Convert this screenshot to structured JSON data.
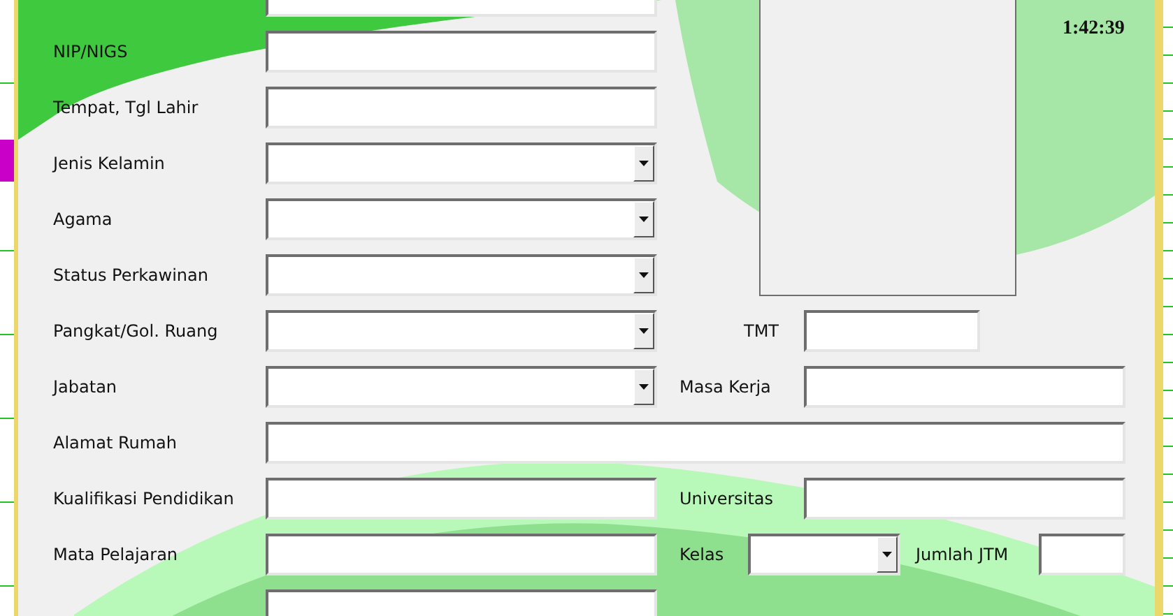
{
  "clock": "1:42:39",
  "rows": [
    {
      "fields": [
        {
          "kind": "text"
        }
      ]
    },
    {
      "fields": [
        {
          "label": "NIP/NIGS",
          "kind": "text"
        }
      ]
    },
    {
      "fields": [
        {
          "label": "Tempat, Tgl Lahir",
          "kind": "text"
        }
      ]
    },
    {
      "fields": [
        {
          "label": "Jenis Kelamin",
          "kind": "combo"
        }
      ]
    },
    {
      "fields": [
        {
          "label": "Agama",
          "kind": "combo"
        }
      ]
    },
    {
      "fields": [
        {
          "label": "Status Perkawinan",
          "kind": "combo"
        }
      ]
    },
    {
      "fields": [
        {
          "label": "Pangkat/Gol. Ruang",
          "kind": "combo"
        },
        {
          "label": "TMT",
          "kind": "short"
        }
      ]
    },
    {
      "fields": [
        {
          "label": "Jabatan",
          "kind": "combo"
        },
        {
          "label": "Masa Kerja",
          "kind": "text"
        }
      ]
    },
    {
      "fields": [
        {
          "label": "Alamat Rumah",
          "kind": "wide"
        }
      ]
    },
    {
      "fields": [
        {
          "label": "Kualifikasi Pendidikan",
          "kind": "text"
        },
        {
          "label": "Universitas",
          "kind": "text"
        }
      ]
    },
    {
      "fields": [
        {
          "label": "Mata Pelajaran",
          "kind": "text"
        },
        {
          "label": "Kelas",
          "kind": "small_combo"
        },
        {
          "label": "Jumlah JTM",
          "kind": "small"
        }
      ]
    },
    {
      "fields": [
        {
          "kind": "text"
        }
      ]
    }
  ]
}
